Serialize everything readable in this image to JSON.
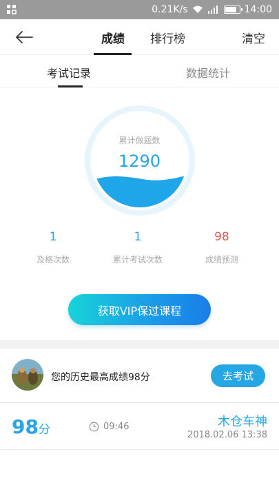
{
  "status_bar": {
    "network_speed": "0.21K/s",
    "time": "14:00",
    "battery_level": 0.85
  },
  "nav": {
    "tabs": [
      "成绩",
      "排行榜"
    ],
    "active_tab": "成绩",
    "clear_label": "清空"
  },
  "sub_tabs": {
    "items": [
      "考试记录",
      "数据统计"
    ],
    "active": "考试记录"
  },
  "gauge": {
    "caption": "累计做题数",
    "value": "1290"
  },
  "stats": [
    {
      "value": "1",
      "label": "及格次数",
      "color": "#28a5e6"
    },
    {
      "value": "1",
      "label": "累计考试次数",
      "color": "#28a5e6"
    },
    {
      "value": "98",
      "label": "成绩预测",
      "color": "#e85a4f"
    }
  ],
  "vip_button": {
    "label": "获取VIP保过课程"
  },
  "best_score": {
    "text": "您的历史最高成绩98分",
    "button_label": "去考试"
  },
  "records": [
    {
      "score": "98",
      "unit": "分",
      "time": "09:46",
      "title": "木仓车神",
      "datetime": "2018.02.06  13:38"
    }
  ],
  "colors": {
    "accent": "#28a5e6",
    "prediction": "#e85a4f"
  }
}
